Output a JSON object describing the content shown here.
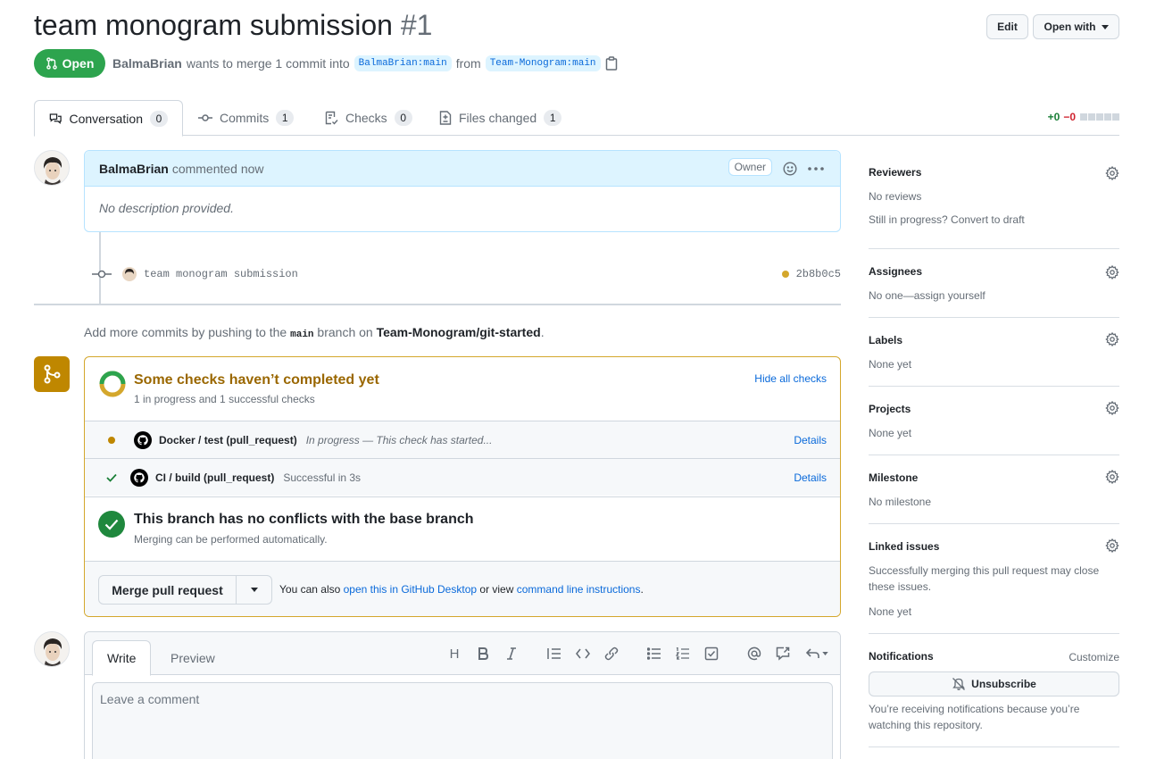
{
  "pr": {
    "title": "team monogram submission",
    "number": "#1",
    "state": "Open",
    "author": "BalmaBrian",
    "merge_text": "wants to merge 1 commit into",
    "base_ref": "BalmaBrian:main",
    "from_text": "from",
    "head_ref": "Team-Monogram:main"
  },
  "header_buttons": {
    "edit": "Edit",
    "open_with": "Open with"
  },
  "tabs": [
    {
      "label": "Conversation",
      "count": "0",
      "icon": "comment-discussion-icon"
    },
    {
      "label": "Commits",
      "count": "1",
      "icon": "git-commit-icon"
    },
    {
      "label": "Checks",
      "count": "0",
      "icon": "checklist-icon"
    },
    {
      "label": "Files changed",
      "count": "1",
      "icon": "file-diff-icon"
    }
  ],
  "diffstat": {
    "additions": "+0",
    "deletions": "−0"
  },
  "comment": {
    "author": "BalmaBrian",
    "action": "commented now",
    "badge": "Owner",
    "body": "No description provided."
  },
  "commit": {
    "message": "team monogram submission",
    "sha": "2b8b0c5",
    "status_color": "#d4a72c"
  },
  "push_hint": {
    "prefix": "Add more commits by pushing to the",
    "branch": "main",
    "middle": "branch on",
    "repo": "Team-Monogram/git-started",
    "suffix": "."
  },
  "checks": {
    "title": "Some checks haven’t completed yet",
    "subtitle": "1 in progress and 1 successful checks",
    "hide_label": "Hide all checks",
    "items": [
      {
        "name": "Docker / test (pull_request)",
        "desc": "In progress — This check has started...",
        "status": "pending",
        "details": "Details"
      },
      {
        "name": "CI / build (pull_request)",
        "desc": "Successful in 3s",
        "status": "success",
        "details": "Details"
      }
    ]
  },
  "no_conflicts": {
    "title": "This branch has no conflicts with the base branch",
    "subtitle": "Merging can be performed automatically."
  },
  "merge": {
    "button": "Merge pull request",
    "hint_prefix": "You can also",
    "desktop_link": "open this in GitHub Desktop",
    "hint_middle": "or view",
    "cli_link": "command line instructions",
    "hint_suffix": "."
  },
  "editor": {
    "write_tab": "Write",
    "preview_tab": "Preview",
    "placeholder": "Leave a comment",
    "heading_tool": "H"
  },
  "sidebar": {
    "reviewers": {
      "title": "Reviewers",
      "value": "No reviews",
      "draft_text": "Still in progress? Convert to draft"
    },
    "assignees": {
      "title": "Assignees",
      "value": "No one—assign yourself"
    },
    "labels": {
      "title": "Labels",
      "value": "None yet"
    },
    "projects": {
      "title": "Projects",
      "value": "None yet"
    },
    "milestone": {
      "title": "Milestone",
      "value": "No milestone"
    },
    "linked_issues": {
      "title": "Linked issues",
      "desc": "Successfully merging this pull request may close these issues.",
      "value": "None yet"
    },
    "notifications": {
      "title": "Notifications",
      "customize": "Customize",
      "unsubscribe": "Unsubscribe",
      "reason": "You’re receiving notifications because you’re watching this repository."
    }
  },
  "colors": {
    "open_green": "#2da44e",
    "pending_yellow": "#bf8700",
    "link_blue": "#0969da"
  }
}
